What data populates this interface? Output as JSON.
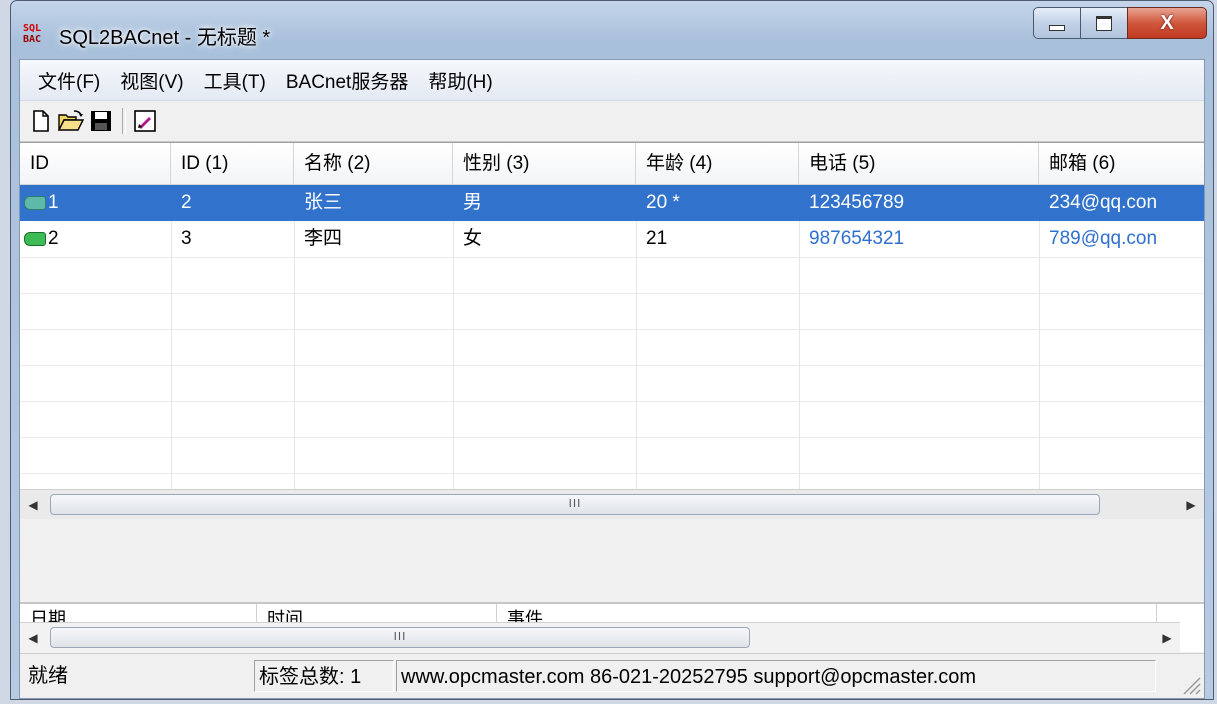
{
  "window": {
    "title": "SQL2BACnet - 无标题 *",
    "icon_text_top": "SQL",
    "icon_text_bottom": "BAC",
    "close_glyph": "X",
    "colors": {
      "selection": "#3072cc",
      "link": "#2f6fd0",
      "tag_green": "#3dbb55",
      "tag_teal": "#5fb9a8"
    }
  },
  "menubar": {
    "items": [
      {
        "label": "文件(F)"
      },
      {
        "label": "视图(V)"
      },
      {
        "label": "工具(T)"
      },
      {
        "label": "BACnet服务器"
      },
      {
        "label": "帮助(H)"
      }
    ]
  },
  "toolbar": {
    "buttons": [
      {
        "icon": "new-file-icon"
      },
      {
        "icon": "open-folder-icon"
      },
      {
        "icon": "save-icon"
      },
      {
        "icon": "edit-tags-icon"
      }
    ]
  },
  "grid": {
    "columns": [
      "ID",
      "ID (1)",
      "名称 (2)",
      "性别 (3)",
      "年龄 (4)",
      "电话 (5)",
      "邮箱 (6)"
    ],
    "rows": [
      {
        "selected": true,
        "tag_icon": "teal-tag-icon",
        "cells": [
          "1",
          "2",
          "张三",
          "男",
          "20 *",
          "123456789",
          "234@qq.con"
        ]
      },
      {
        "selected": false,
        "tag_icon": "green-tag-icon",
        "cells": [
          "2",
          "3",
          "李四",
          "女",
          "21",
          "987654321",
          "789@qq.con"
        ]
      }
    ],
    "scroll_thumb_glyph": "III"
  },
  "log": {
    "columns": [
      "日期",
      "时间",
      "事件"
    ],
    "scroll_thumb_glyph": "III"
  },
  "statusbar": {
    "ready": "就绪",
    "tag_count": "标签总数: 1",
    "contact": "www.opcmaster.com 86-021-20252795 support@opcmaster.com"
  }
}
